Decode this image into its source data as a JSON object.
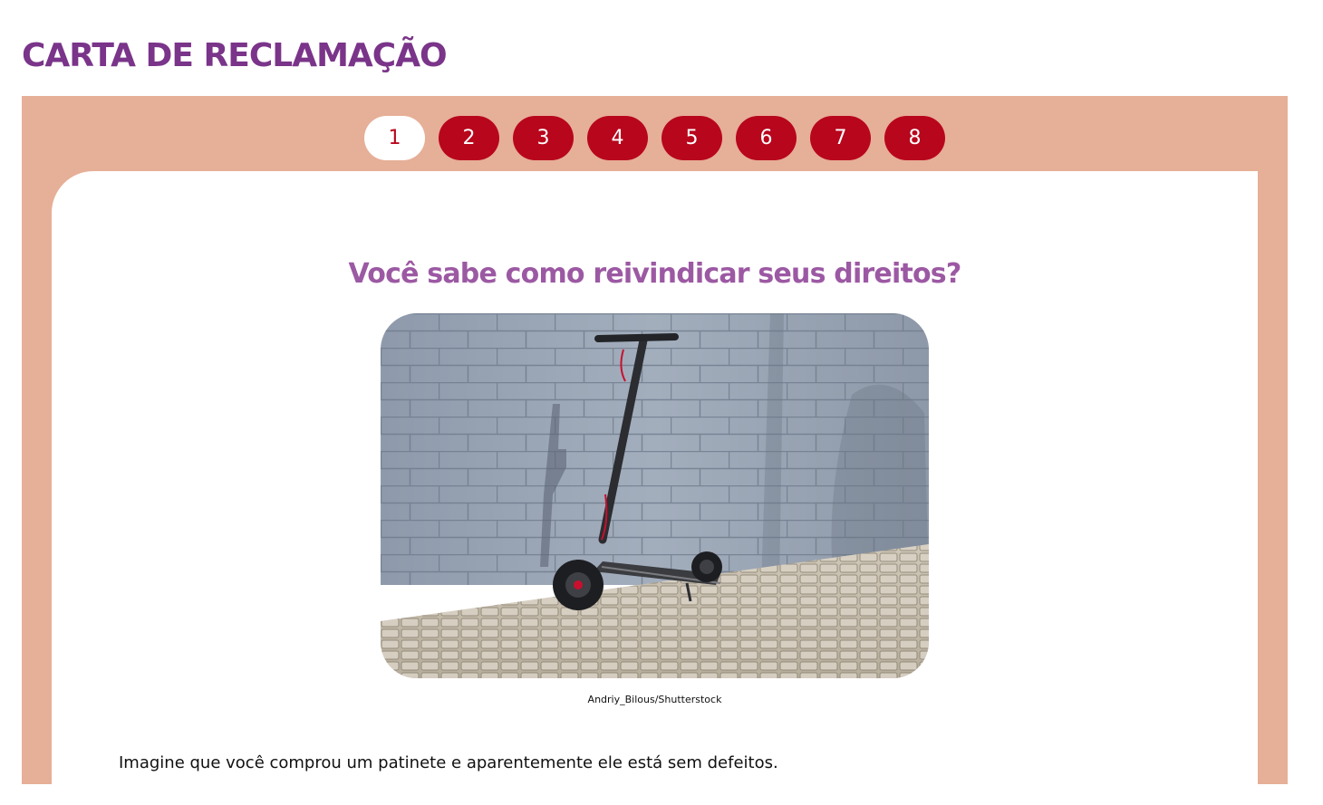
{
  "page": {
    "title": "CARTA DE RECLAMAÇÃO"
  },
  "pager": {
    "active": 1,
    "pages": [
      {
        "label": "1"
      },
      {
        "label": "2"
      },
      {
        "label": "3"
      },
      {
        "label": "4"
      },
      {
        "label": "5"
      },
      {
        "label": "6"
      },
      {
        "label": "7"
      },
      {
        "label": "8"
      }
    ]
  },
  "content": {
    "question": "Você sabe como reivindicar seus direitos?",
    "image": {
      "subject": "electric-scooter-against-brick-wall",
      "credit": "Andriy_Bilous/Shutterstock"
    },
    "intro": "Imagine que você comprou um patinete e aparentemente ele está sem defeitos."
  },
  "colors": {
    "title": "#7a3489",
    "question": "#9c59a3",
    "panel": "#e6af97",
    "button": "#b8061d",
    "button_text": "#ffffff",
    "active_button": "#ffffff",
    "active_button_text": "#b8061d"
  }
}
